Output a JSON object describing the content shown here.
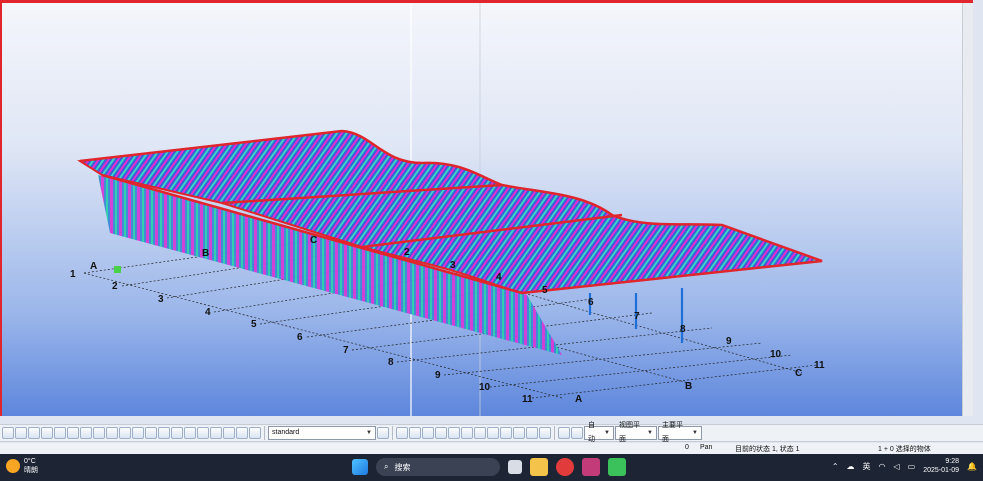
{
  "grid_labels": {
    "rows": [
      "A",
      "B",
      "C"
    ],
    "cols": [
      "1",
      "2",
      "3",
      "4",
      "5",
      "6",
      "7",
      "8",
      "9",
      "10",
      "11"
    ]
  },
  "toolbar": {
    "style_select": "standard",
    "auto_select": "自动",
    "view_plane_select": "视图平面",
    "work_plane_select": "主要平面"
  },
  "statusbar": {
    "count": "0",
    "mode": "Pan",
    "state": "目前的状态 1, 状态 1",
    "selection": "1 + 0 选择的物体"
  },
  "taskbar": {
    "weather_temp": "0°C",
    "weather_text": "晴朗",
    "search_placeholder": "搜索",
    "ime": "英",
    "time": "9:28",
    "date": "2025-01-09"
  },
  "colors": {
    "viewport_border": "#e0262c",
    "taskbar_bg": "#1d2433"
  },
  "icons": [
    "search-icon",
    "wechat-icon",
    "folder-icon",
    "wifi-icon",
    "volume-icon",
    "battery-icon",
    "notification-icon"
  ]
}
